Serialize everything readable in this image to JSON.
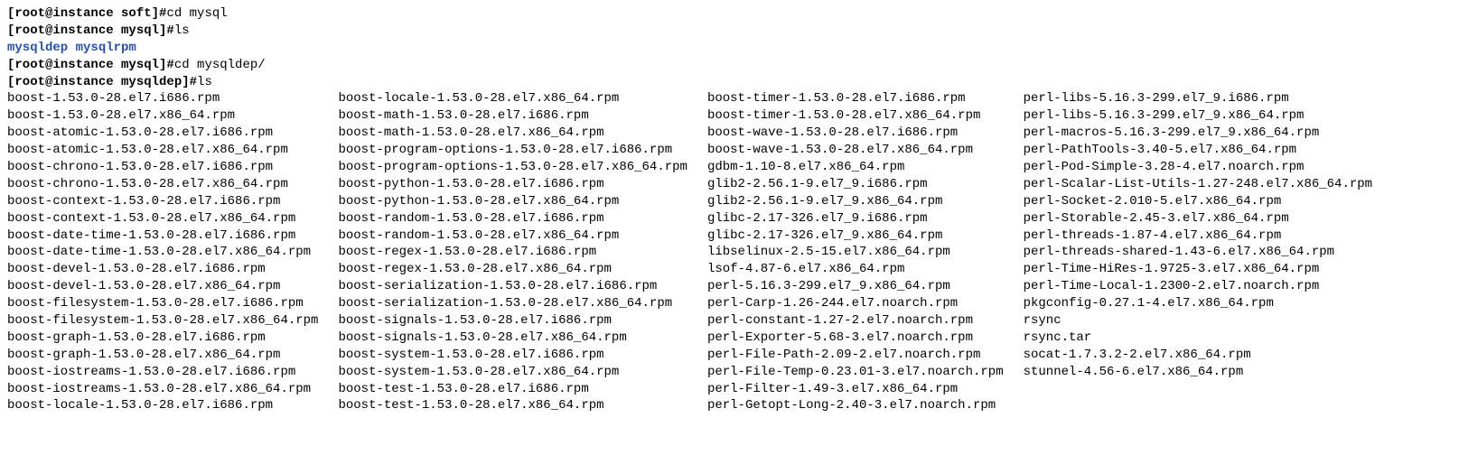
{
  "prompts": [
    {
      "prompt": "[root@instance soft]# ",
      "cmd": "cd mysql"
    },
    {
      "prompt": "[root@instance mysql]# ",
      "cmd": "ls"
    }
  ],
  "ls_mysql": "mysqldep  mysqlrpm",
  "prompts2": [
    {
      "prompt": "[root@instance mysql]# ",
      "cmd": "cd mysqldep/"
    },
    {
      "prompt": "[root@instance mysqldep]# ",
      "cmd": "ls"
    }
  ],
  "columns": [
    [
      "boost-1.53.0-28.el7.i686.rpm",
      "boost-1.53.0-28.el7.x86_64.rpm",
      "boost-atomic-1.53.0-28.el7.i686.rpm",
      "boost-atomic-1.53.0-28.el7.x86_64.rpm",
      "boost-chrono-1.53.0-28.el7.i686.rpm",
      "boost-chrono-1.53.0-28.el7.x86_64.rpm",
      "boost-context-1.53.0-28.el7.i686.rpm",
      "boost-context-1.53.0-28.el7.x86_64.rpm",
      "boost-date-time-1.53.0-28.el7.i686.rpm",
      "boost-date-time-1.53.0-28.el7.x86_64.rpm",
      "boost-devel-1.53.0-28.el7.i686.rpm",
      "boost-devel-1.53.0-28.el7.x86_64.rpm",
      "boost-filesystem-1.53.0-28.el7.i686.rpm",
      "boost-filesystem-1.53.0-28.el7.x86_64.rpm",
      "boost-graph-1.53.0-28.el7.i686.rpm",
      "boost-graph-1.53.0-28.el7.x86_64.rpm",
      "boost-iostreams-1.53.0-28.el7.i686.rpm",
      "boost-iostreams-1.53.0-28.el7.x86_64.rpm",
      "boost-locale-1.53.0-28.el7.i686.rpm"
    ],
    [
      "boost-locale-1.53.0-28.el7.x86_64.rpm",
      "boost-math-1.53.0-28.el7.i686.rpm",
      "boost-math-1.53.0-28.el7.x86_64.rpm",
      "boost-program-options-1.53.0-28.el7.i686.rpm",
      "boost-program-options-1.53.0-28.el7.x86_64.rpm",
      "boost-python-1.53.0-28.el7.i686.rpm",
      "boost-python-1.53.0-28.el7.x86_64.rpm",
      "boost-random-1.53.0-28.el7.i686.rpm",
      "boost-random-1.53.0-28.el7.x86_64.rpm",
      "boost-regex-1.53.0-28.el7.i686.rpm",
      "boost-regex-1.53.0-28.el7.x86_64.rpm",
      "boost-serialization-1.53.0-28.el7.i686.rpm",
      "boost-serialization-1.53.0-28.el7.x86_64.rpm",
      "boost-signals-1.53.0-28.el7.i686.rpm",
      "boost-signals-1.53.0-28.el7.x86_64.rpm",
      "boost-system-1.53.0-28.el7.i686.rpm",
      "boost-system-1.53.0-28.el7.x86_64.rpm",
      "boost-test-1.53.0-28.el7.i686.rpm",
      "boost-test-1.53.0-28.el7.x86_64.rpm"
    ],
    [
      "boost-timer-1.53.0-28.el7.i686.rpm",
      "boost-timer-1.53.0-28.el7.x86_64.rpm",
      "boost-wave-1.53.0-28.el7.i686.rpm",
      "boost-wave-1.53.0-28.el7.x86_64.rpm",
      "gdbm-1.10-8.el7.x86_64.rpm",
      "glib2-2.56.1-9.el7_9.i686.rpm",
      "glib2-2.56.1-9.el7_9.x86_64.rpm",
      "glibc-2.17-326.el7_9.i686.rpm",
      "glibc-2.17-326.el7_9.x86_64.rpm",
      "libselinux-2.5-15.el7.x86_64.rpm",
      "lsof-4.87-6.el7.x86_64.rpm",
      "perl-5.16.3-299.el7_9.x86_64.rpm",
      "perl-Carp-1.26-244.el7.noarch.rpm",
      "perl-constant-1.27-2.el7.noarch.rpm",
      "perl-Exporter-5.68-3.el7.noarch.rpm",
      "perl-File-Path-2.09-2.el7.noarch.rpm",
      "perl-File-Temp-0.23.01-3.el7.noarch.rpm",
      "perl-Filter-1.49-3.el7.x86_64.rpm",
      "perl-Getopt-Long-2.40-3.el7.noarch.rpm"
    ],
    [
      "perl-libs-5.16.3-299.el7_9.i686.rpm",
      "perl-libs-5.16.3-299.el7_9.x86_64.rpm",
      "perl-macros-5.16.3-299.el7_9.x86_64.rpm",
      "perl-PathTools-3.40-5.el7.x86_64.rpm",
      "perl-Pod-Simple-3.28-4.el7.noarch.rpm",
      "perl-Scalar-List-Utils-1.27-248.el7.x86_64.rpm",
      "perl-Socket-2.010-5.el7.x86_64.rpm",
      "perl-Storable-2.45-3.el7.x86_64.rpm",
      "perl-threads-1.87-4.el7.x86_64.rpm",
      "perl-threads-shared-1.43-6.el7.x86_64.rpm",
      "perl-Time-HiRes-1.9725-3.el7.x86_64.rpm",
      "perl-Time-Local-1.2300-2.el7.noarch.rpm",
      "pkgconfig-0.27.1-4.el7.x86_64.rpm",
      "rsync",
      "rsync.tar",
      "socat-1.7.3.2-2.el7.x86_64.rpm",
      "stunnel-4.56-6.el7.x86_64.rpm"
    ]
  ],
  "special_colors": {
    "rsync.tar": "red"
  }
}
